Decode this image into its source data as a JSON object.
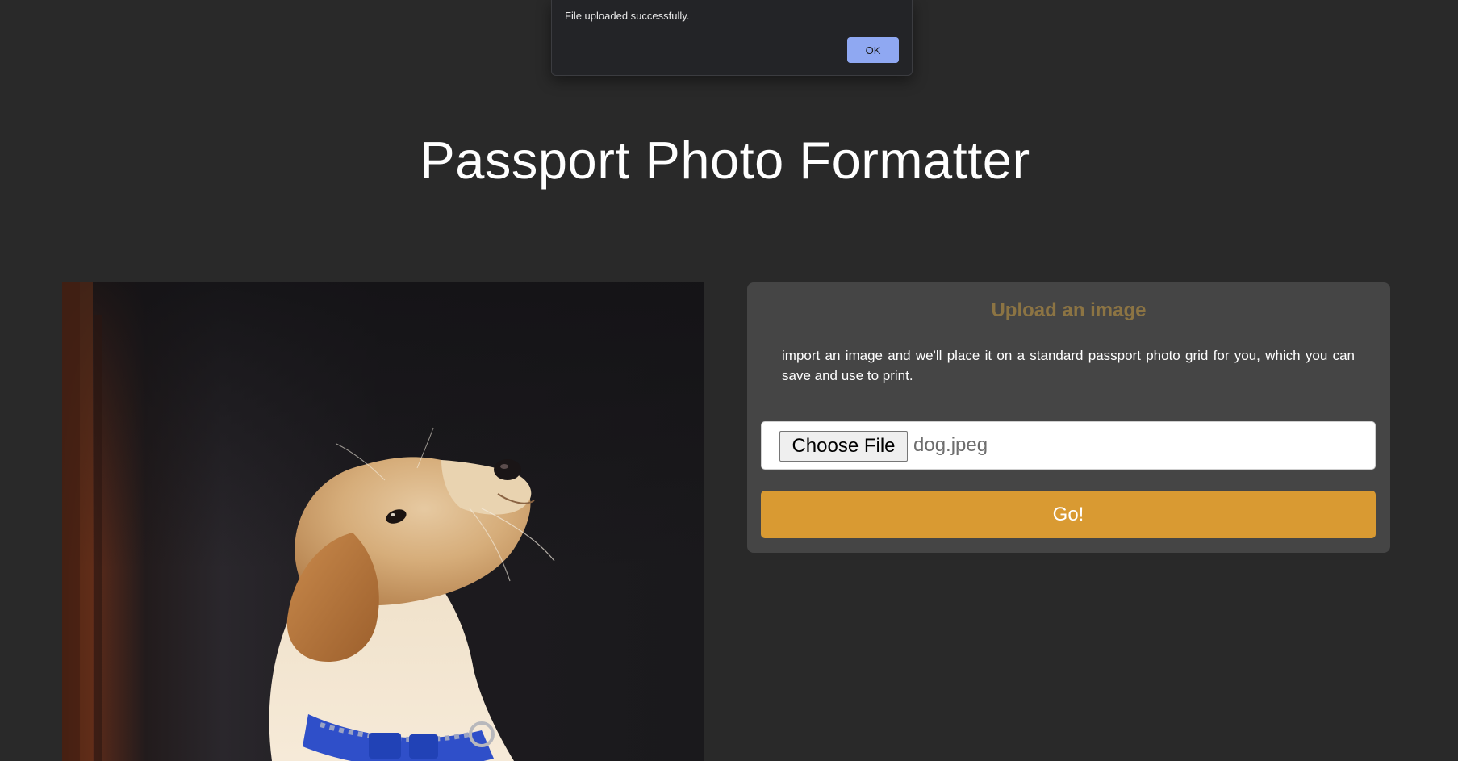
{
  "alert": {
    "message": "File uploaded successfully.",
    "ok_label": "OK"
  },
  "header": {
    "title": "Passport Photo Formatter"
  },
  "preview": {
    "subject": "golden retriever puppy looking up, blue collar, dark background"
  },
  "upload_card": {
    "title": "Upload an image",
    "description": "import an image and we'll place it on a standard passport photo grid for you, which you can save and use to print.",
    "file_input": {
      "button_label": "Choose File",
      "file_name": "dog.jpeg"
    },
    "submit_label": "Go!"
  },
  "colors": {
    "background": "#292929",
    "card": "#454545",
    "accent": "#d99a32",
    "card_title": "#8c7443",
    "ok_button": "#8fa8f2"
  }
}
